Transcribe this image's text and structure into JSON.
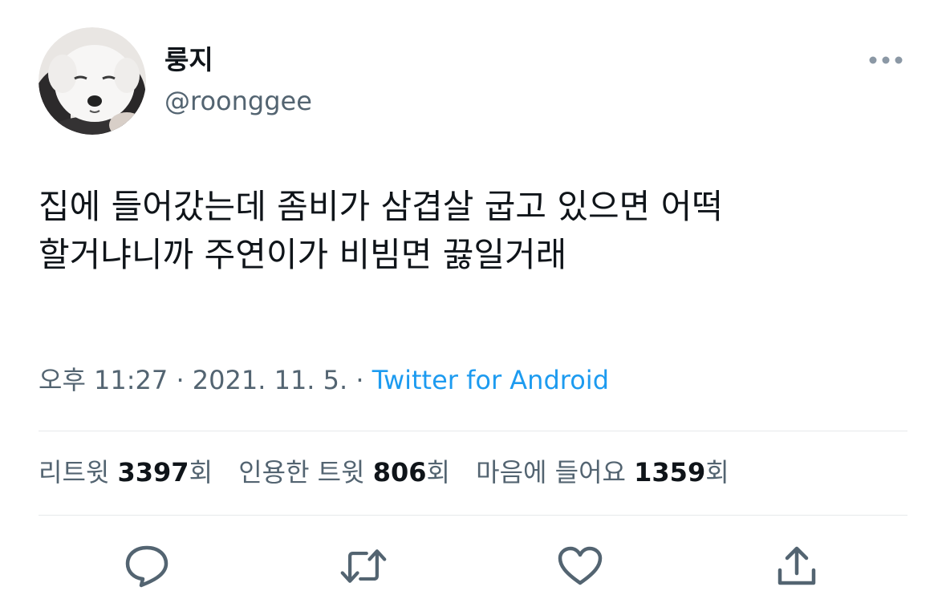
{
  "author": {
    "display_name": "룽지",
    "handle": "@roonggee"
  },
  "tweet": {
    "text_line1": "집에 들어갔는데 좀비가 삼겹살 굽고 있으면 어떡",
    "text_line2": "할거냐니까 주연이가 비빔면 끓일거래",
    "time": "오후 11:27",
    "sep1": " · ",
    "date": "2021. 11. 5.",
    "sep2": " · ",
    "source": "Twitter for Android"
  },
  "stats": {
    "retweets_label": "리트윗 ",
    "retweets_count": "3397",
    "retweets_unit": "회",
    "quotes_label": "인용한 트윗 ",
    "quotes_count": "806",
    "quotes_unit": "회",
    "likes_label": "마음에 들어요 ",
    "likes_count": "1359",
    "likes_unit": "회"
  },
  "icons": {
    "more": "more-dots-icon",
    "reply": "reply-bubble-icon",
    "retweet": "retweet-icon",
    "like": "heart-icon",
    "share": "share-upload-icon"
  },
  "colors": {
    "text": "#0f1419",
    "secondary": "#536471",
    "link": "#1d9bf0",
    "divider": "#e6e9eb"
  }
}
